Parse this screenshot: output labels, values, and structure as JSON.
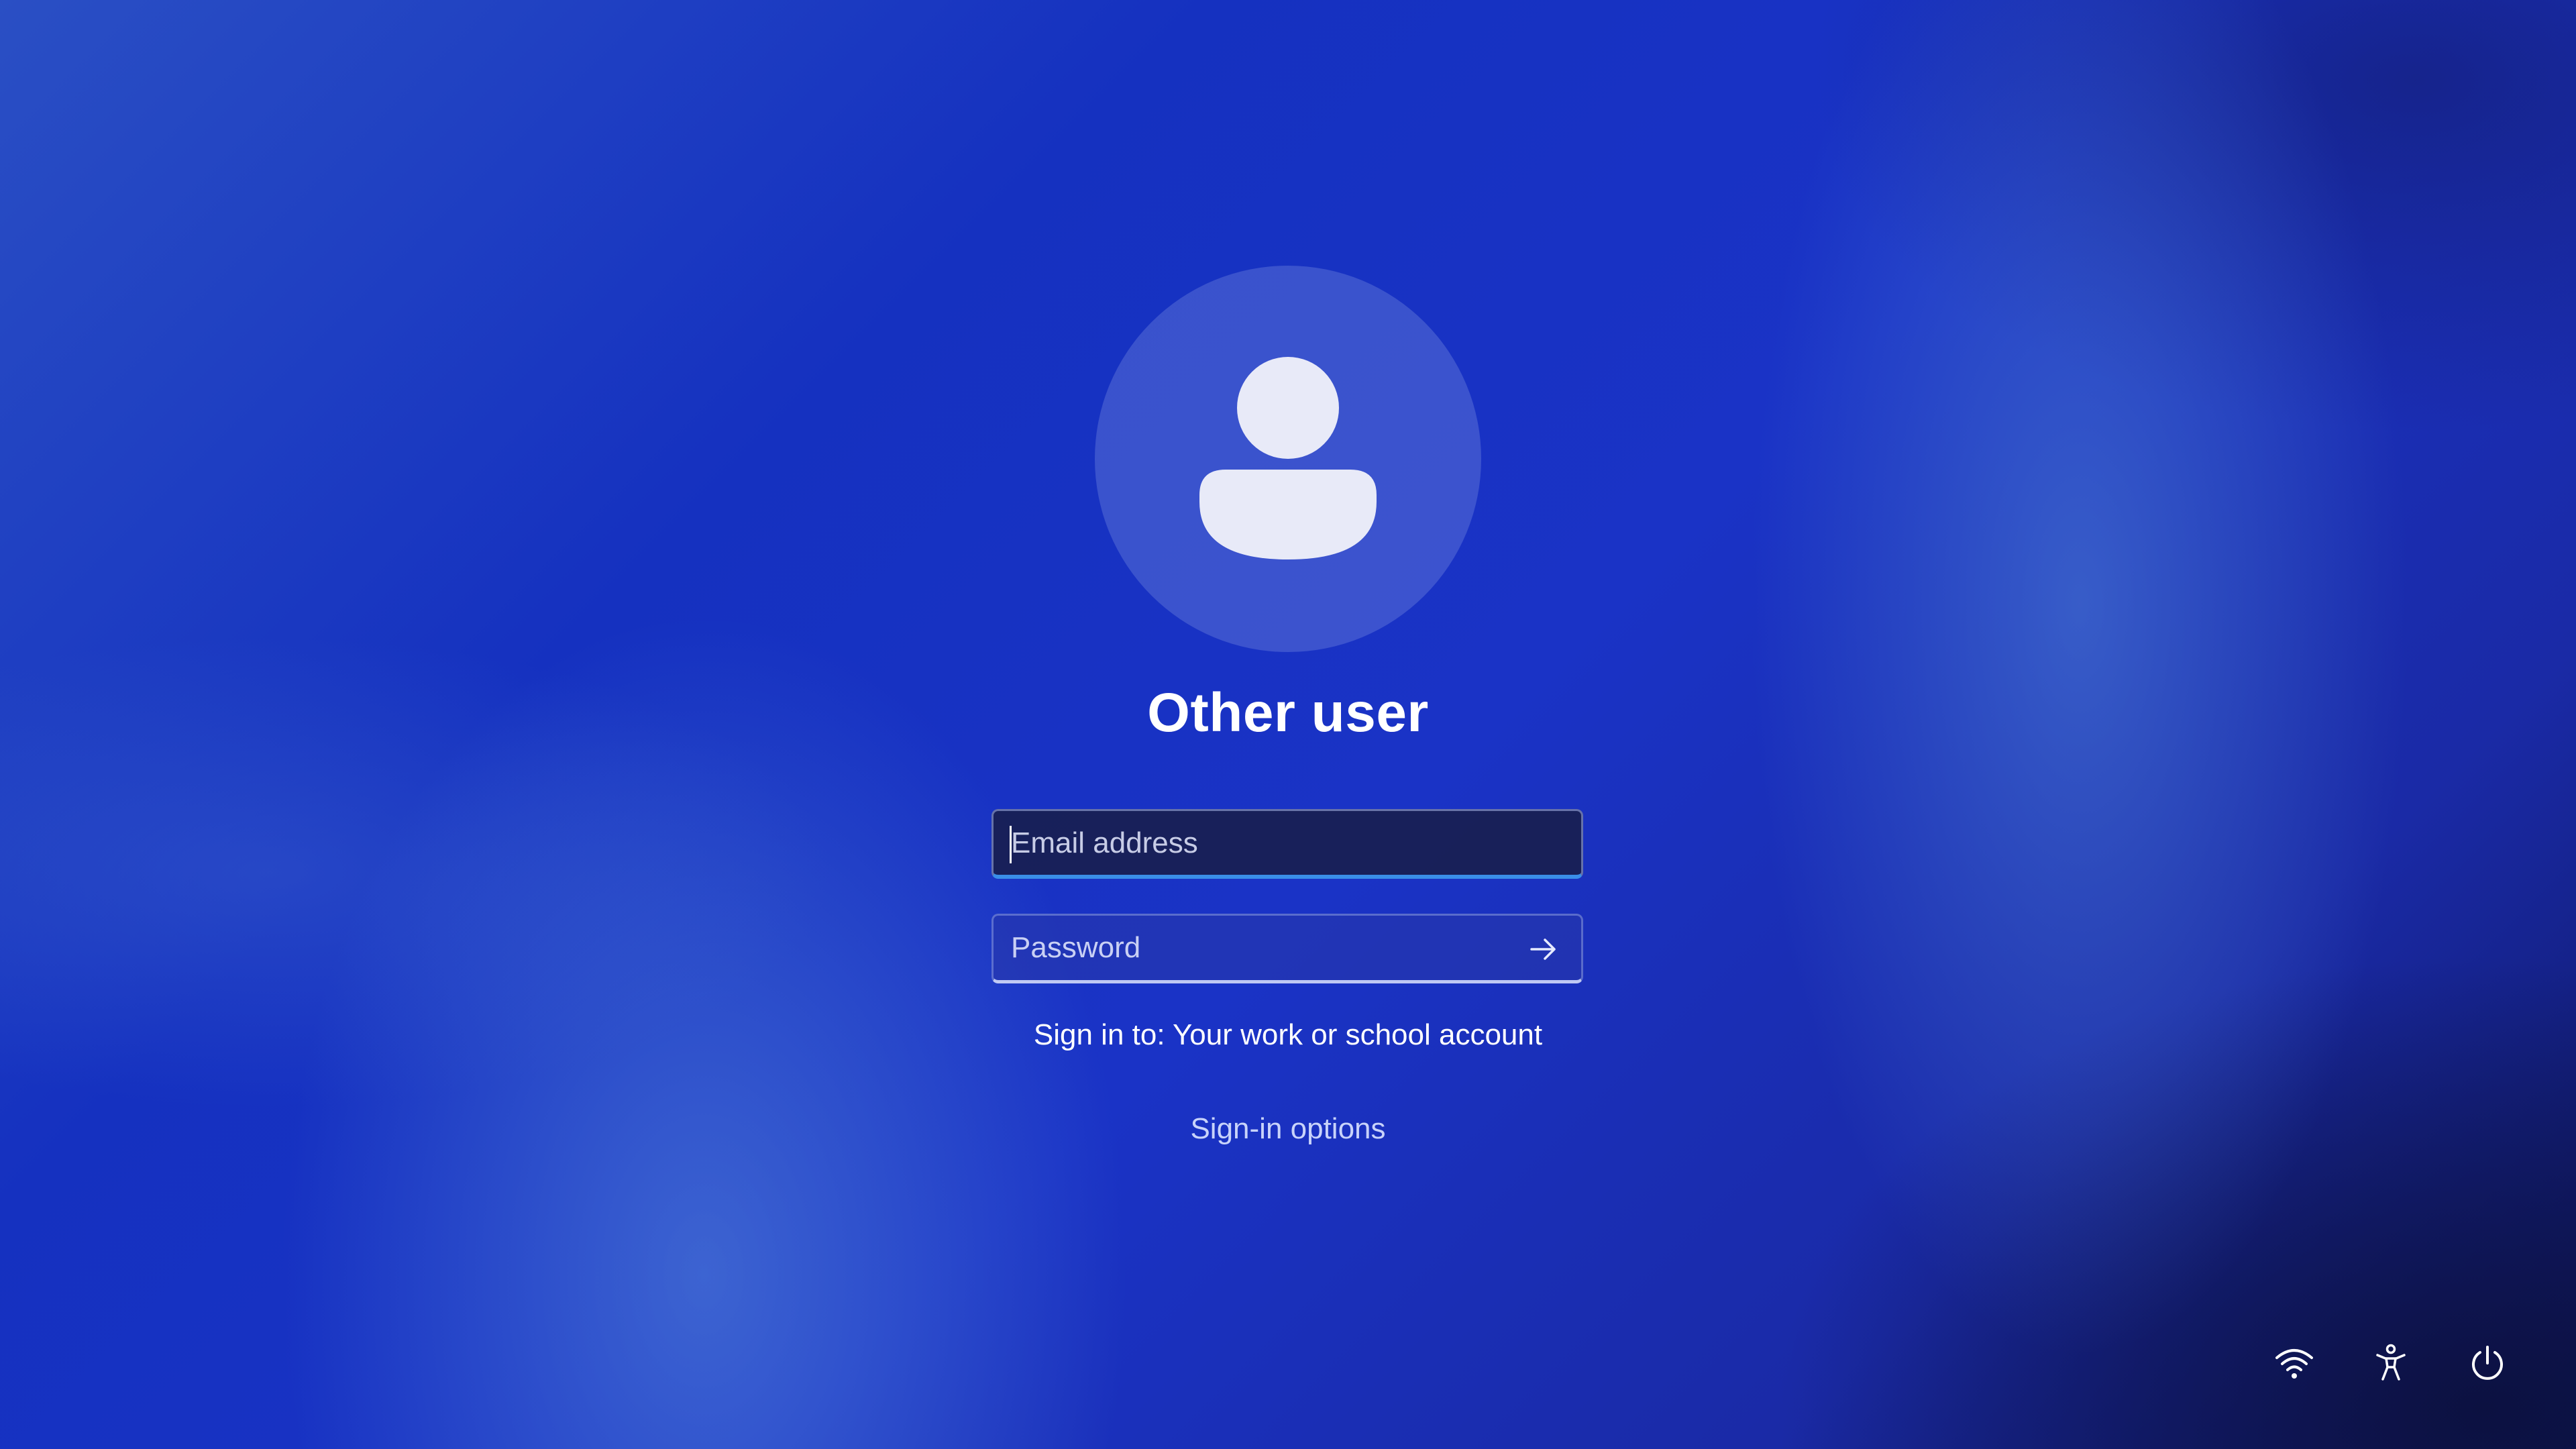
{
  "user": {
    "name": "Other user"
  },
  "form": {
    "email": {
      "placeholder": "Email address",
      "value": ""
    },
    "password": {
      "placeholder": "Password",
      "value": ""
    },
    "sign_in_to": "Sign in to: Your work or school account",
    "sign_in_options": "Sign-in options"
  },
  "icons": {
    "avatar": "person-icon",
    "submit": "arrow-right-icon",
    "network": "wifi-icon",
    "accessibility": "accessibility-icon",
    "power": "power-icon"
  },
  "colors": {
    "accent": "#3a8ee8",
    "background": "#1a33c6"
  }
}
